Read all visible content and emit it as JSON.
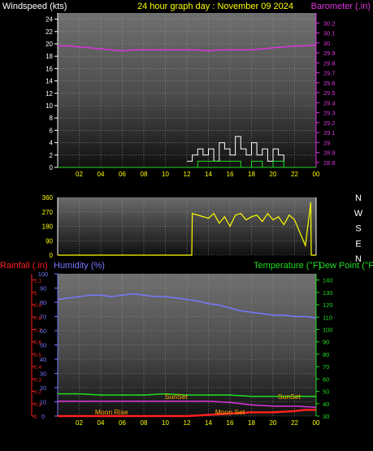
{
  "header": {
    "left_label": "Windspeed (kts)",
    "title": "24 hour graph day : November 09 2024",
    "right_label": "Barometer (.in)"
  },
  "lower_header": {
    "rainfall_label": "Rainfall (.in)",
    "humidity_label": "Humidity (%)",
    "temperature_label": "Temperature (°F)",
    "dewpoint_label": "Dew Point (°F)"
  },
  "colors": {
    "wind_axis": "#ffffff",
    "barometer": "#dd33dd",
    "direction": "#ffff00",
    "rain": "#ff2020",
    "humidity": "#7777ff",
    "temperature": "#22dd22",
    "x_axis_labels": "#ffff00",
    "sun_moon_labels": "#ffaa00"
  },
  "chart_data": [
    {
      "type": "line",
      "title": "24 hour graph day : November 09 2024",
      "xlabel": "",
      "x_ticks": [
        "02",
        "04",
        "06",
        "08",
        "10",
        "12",
        "14",
        "16",
        "18",
        "20",
        "22",
        "00"
      ],
      "left_axis": {
        "label": "Windspeed (kts)",
        "ticks": [
          0,
          2,
          4,
          6,
          8,
          10,
          12,
          14,
          16,
          18,
          20,
          22,
          24
        ],
        "ylim": [
          0,
          25
        ]
      },
      "right_axis": {
        "label": "Barometer (.in)",
        "ticks": [
          28.8,
          28.9,
          29,
          29.1,
          29.2,
          29.3,
          29.4,
          29.5,
          29.6,
          29.7,
          29.8,
          29.9,
          30,
          30.1,
          30.2
        ],
        "ylim": [
          28.75,
          30.3
        ]
      },
      "series": [
        {
          "name": "Barometer (.in)",
          "axis": "right",
          "x_hours": [
            0,
            1,
            2,
            3,
            4,
            5,
            6,
            7,
            8,
            9,
            10,
            11,
            12,
            13,
            14,
            15,
            16,
            17,
            18,
            19,
            20,
            21,
            22,
            23,
            24
          ],
          "values": [
            29.97,
            29.97,
            29.96,
            29.95,
            29.94,
            29.93,
            29.92,
            29.93,
            29.93,
            29.93,
            29.93,
            29.93,
            29.93,
            29.93,
            29.92,
            29.93,
            29.93,
            29.93,
            29.93,
            29.94,
            29.95,
            29.96,
            29.97,
            29.97,
            29.98
          ]
        },
        {
          "axis": "left",
          "style": "gust",
          "x_hours": [
            12,
            12.5,
            13,
            13.5,
            14,
            14.5,
            15,
            15.5,
            16,
            16.5,
            17,
            17.5,
            18,
            18.5,
            19,
            19.5,
            20,
            20.5,
            21
          ],
          "values": [
            1,
            2,
            3,
            2,
            3,
            1,
            4,
            3,
            2,
            5,
            3,
            2,
            4,
            2,
            3,
            1,
            3,
            2,
            1
          ]
        },
        {
          "axis": "left",
          "style": "average",
          "x_hours": [
            12,
            13,
            14,
            15,
            16,
            17,
            18,
            19,
            20,
            21
          ],
          "values": [
            0,
            1,
            1,
            1,
            1,
            0,
            1,
            0,
            1,
            0
          ]
        }
      ]
    },
    {
      "type": "scatter",
      "ylabel_right": [
        "N",
        "W",
        "S",
        "E",
        "N"
      ],
      "y_ticks": [
        0,
        90,
        180,
        270,
        360
      ],
      "ylim": [
        0,
        360
      ],
      "series": [
        {
          "name": "Wind direction",
          "x_hours": [
            12.5,
            13,
            13.5,
            14,
            14.5,
            15,
            15.5,
            16,
            16.5,
            17,
            17.5,
            18,
            18.5,
            19,
            19.5,
            20,
            20.5,
            21,
            21.5,
            22,
            22.5,
            23,
            23.5
          ],
          "values": [
            260,
            250,
            240,
            230,
            260,
            200,
            240,
            180,
            250,
            260,
            220,
            240,
            250,
            210,
            260,
            220,
            240,
            190,
            250,
            220,
            140,
            60,
            330
          ]
        }
      ]
    },
    {
      "type": "line",
      "x_ticks": [
        "02",
        "04",
        "06",
        "08",
        "10",
        "12",
        "14",
        "16",
        "18",
        "20",
        "22",
        "00"
      ],
      "left_axis_1": {
        "label": "Rainfall (.in)",
        "ticks": [
          0,
          0.1,
          0.2,
          0.3,
          0.4,
          0.5,
          0.6,
          0.7,
          0.8,
          0.9,
          1,
          1.1
        ],
        "ylim": [
          0,
          1.15
        ]
      },
      "left_axis_2": {
        "label": "Humidity (%)",
        "ticks": [
          0,
          10,
          20,
          30,
          40,
          50,
          60,
          70,
          80,
          90,
          100
        ],
        "ylim": [
          0,
          100
        ]
      },
      "right_axis": {
        "label": "Temperature (°F)",
        "ticks": [
          30,
          40,
          50,
          60,
          70,
          80,
          90,
          100,
          110,
          120,
          130,
          140
        ],
        "ylim": [
          30,
          145
        ]
      },
      "annotations": [
        {
          "label": "SunSet",
          "hour": 11
        },
        {
          "label": "SunSet",
          "hour": 21.5
        },
        {
          "label": "Moon Rise",
          "hour": 5
        },
        {
          "label": "Moon Set",
          "hour": 16
        }
      ],
      "series": [
        {
          "name": "Humidity (%)",
          "axis": "left_2",
          "x_hours": [
            0,
            1,
            2,
            3,
            4,
            5,
            6,
            7,
            8,
            9,
            10,
            11,
            12,
            13,
            14,
            15,
            16,
            17,
            18,
            19,
            20,
            21,
            22,
            23,
            24
          ],
          "values": [
            82,
            83,
            84,
            85,
            85,
            84,
            85,
            86,
            85,
            84,
            84,
            83,
            82,
            81,
            79,
            78,
            76,
            74,
            73,
            72,
            71,
            71,
            70,
            70,
            69
          ]
        },
        {
          "name": "Temperature (°F)",
          "axis": "right",
          "x_hours": [
            0,
            2,
            4,
            6,
            8,
            10,
            12,
            14,
            16,
            18,
            20,
            22,
            24
          ],
          "values": [
            48,
            48,
            47,
            47,
            47,
            48,
            47,
            47,
            47,
            46,
            46,
            46,
            46
          ]
        },
        {
          "name": "Dew Point (°F)",
          "axis": "right",
          "x_hours": [
            0,
            2,
            4,
            6,
            8,
            10,
            12,
            14,
            16,
            18,
            20,
            22,
            24
          ],
          "values": [
            42,
            42,
            42,
            42,
            42,
            42,
            42,
            42,
            41,
            39,
            38,
            38,
            37
          ]
        },
        {
          "name": "Rainfall (.in)",
          "axis": "left_1",
          "x_hours": [
            0,
            6,
            12,
            16,
            18,
            20,
            22,
            23,
            24
          ],
          "values": [
            0,
            0,
            0,
            0.02,
            0.03,
            0.03,
            0.04,
            0.05,
            0.05
          ]
        }
      ]
    }
  ]
}
